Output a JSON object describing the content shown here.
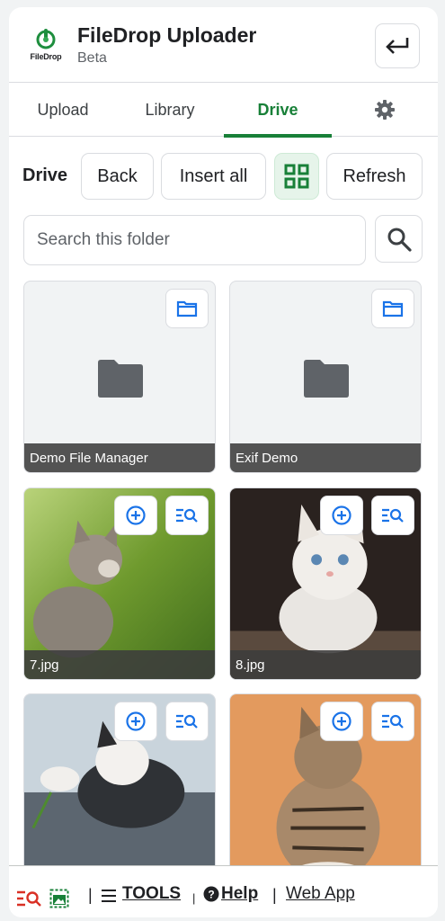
{
  "header": {
    "logo_text": "FileDrop",
    "title": "FileDrop Uploader",
    "subtitle": "Beta",
    "exit_icon": "return-arrow-icon"
  },
  "tabs": [
    {
      "label": "Upload",
      "active": false
    },
    {
      "label": "Library",
      "active": false
    },
    {
      "label": "Drive",
      "active": true
    },
    {
      "label": "",
      "icon": "gear-icon",
      "active": false
    }
  ],
  "toolbar": {
    "section_label": "Drive",
    "back_label": "Back",
    "insert_all_label": "Insert all",
    "grid_view_icon": "grid-view-icon",
    "refresh_label": "Refresh"
  },
  "search": {
    "placeholder": "Search this folder",
    "button_icon": "search-icon"
  },
  "items": [
    {
      "type": "folder",
      "name": "Demo File Manager"
    },
    {
      "type": "folder",
      "name": "Exif Demo"
    },
    {
      "type": "image",
      "name": "7.jpg"
    },
    {
      "type": "image",
      "name": "8.jpg"
    },
    {
      "type": "image",
      "name": ""
    },
    {
      "type": "image",
      "name": ""
    }
  ],
  "footer": {
    "tools_label": "TOOLS",
    "help_label": "Help",
    "webapp_label": "Web App"
  },
  "colors": {
    "accent_green": "#188038",
    "action_blue": "#1a73e8",
    "footer_red": "#d93025"
  }
}
